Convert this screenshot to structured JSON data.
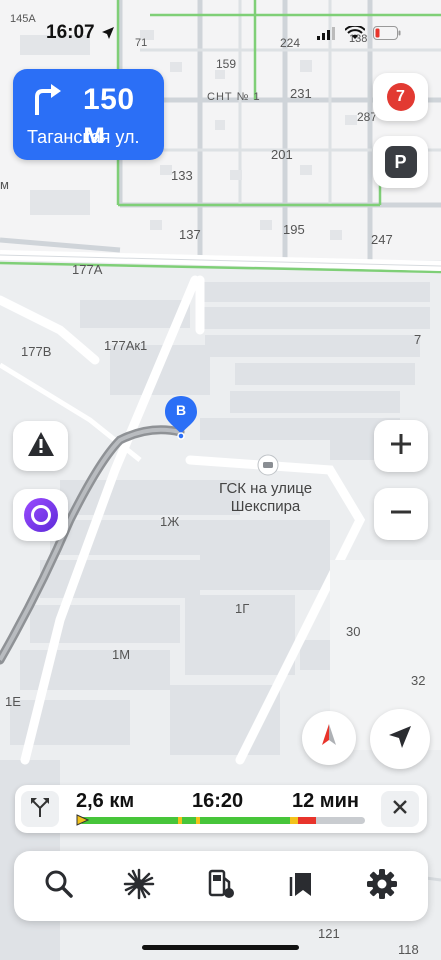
{
  "status_bar": {
    "time": "16:07"
  },
  "maneuver": {
    "distance": "150 м",
    "street": "Таганская ул."
  },
  "badges": {
    "traffic_level": "7",
    "parking_label": "P"
  },
  "map_labels": {
    "n145a": "145А",
    "n71": "71",
    "n138": "138",
    "n159": "159",
    "n224": "224",
    "n231": "231",
    "snt": "СНТ № 1",
    "n287": "287",
    "n201": "201",
    "n133": "133",
    "m_left": "м",
    "n137": "137",
    "n195": "195",
    "n247": "247",
    "n177a": "177А",
    "n177ak1": "177Ак1",
    "n177v": "177В",
    "n7": "7",
    "n1zh": "1Ж",
    "n1g": "1Г",
    "n30": "30",
    "n1m": "1М",
    "n32": "32",
    "n1e": "1Е",
    "n121": "121",
    "n118": "118"
  },
  "poi": {
    "name_line1": "ГСК на улице",
    "name_line2": "Шекспира"
  },
  "destination_marker": "B",
  "route": {
    "distance": "2,6 км",
    "arrival": "16:20",
    "duration": "12 мин"
  },
  "colors": {
    "accent": "#2b6ff6",
    "traffic_green": "#47c53a",
    "traffic_yellow": "#f2c21b",
    "traffic_red": "#e8342b",
    "route_gray": "#8f9296"
  },
  "toolbar": [
    "search-icon",
    "mood-icon",
    "fuel-icon",
    "bookmarks-icon",
    "settings-icon"
  ]
}
